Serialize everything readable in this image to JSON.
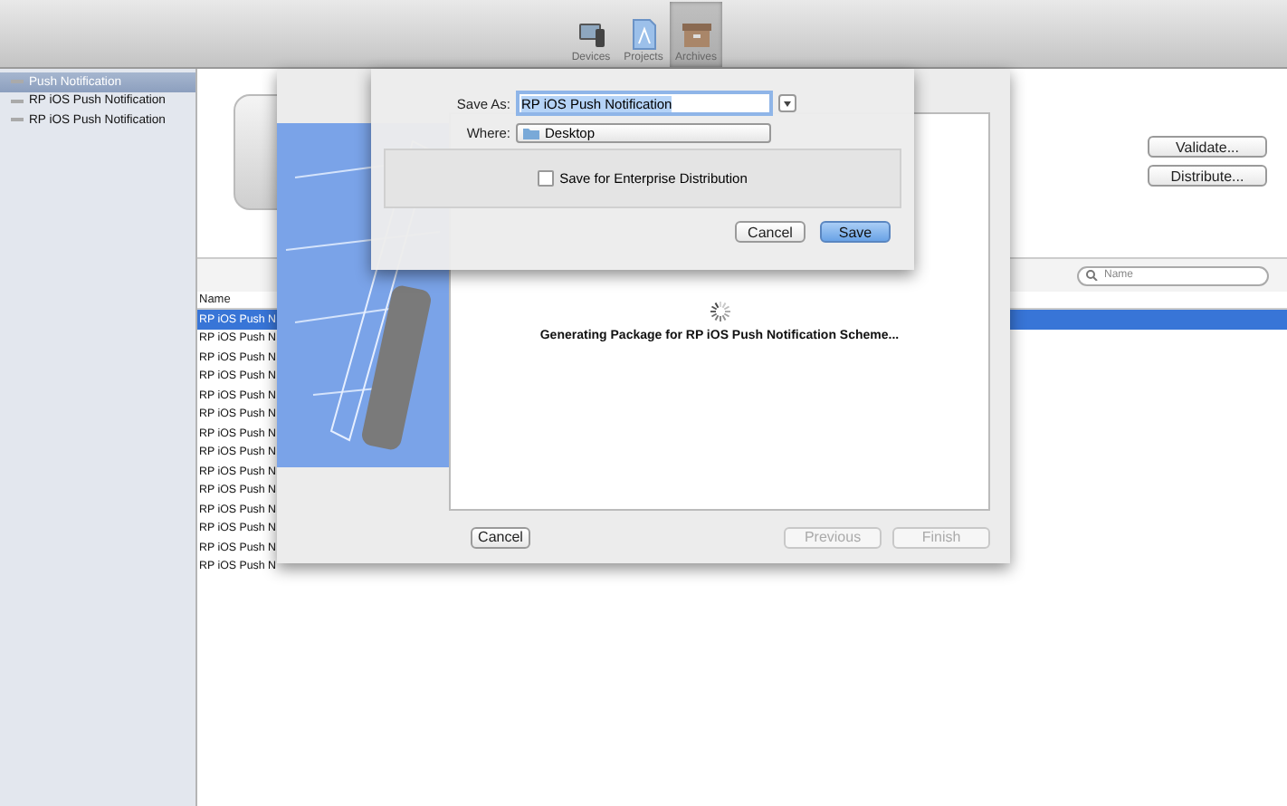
{
  "toolbar": {
    "items": [
      {
        "label": "Devices",
        "selected": false
      },
      {
        "label": "Projects",
        "selected": false
      },
      {
        "label": "Archives",
        "selected": true
      }
    ]
  },
  "sidebar": {
    "items": [
      {
        "label": "Push Notification",
        "selected": true
      },
      {
        "label": "RP iOS Push Notification",
        "selected": false
      },
      {
        "label": "RP iOS Push Notification",
        "selected": false
      }
    ]
  },
  "actions": [
    "Validate...",
    "Distribute..."
  ],
  "search": {
    "placeholder": "Name"
  },
  "table": {
    "columns": [
      "Name"
    ],
    "rows": [
      {
        "name": "RP iOS Push N",
        "selected": true
      },
      {
        "name": "RP iOS Push N",
        "selected": false
      },
      {
        "name": "RP iOS Push N",
        "selected": false
      },
      {
        "name": "RP iOS Push N",
        "selected": false
      },
      {
        "name": "RP iOS Push N",
        "selected": false
      },
      {
        "name": "RP iOS Push N",
        "selected": false
      },
      {
        "name": "RP iOS Push N",
        "selected": false
      },
      {
        "name": "RP iOS Push N",
        "selected": false
      },
      {
        "name": "RP iOS Push N",
        "selected": false
      },
      {
        "name": "RP iOS Push N",
        "selected": false
      },
      {
        "name": "RP iOS Push N",
        "selected": false
      },
      {
        "name": "RP iOS Push N",
        "selected": false
      },
      {
        "name": "RP iOS Push N",
        "selected": false
      },
      {
        "name": "RP iOS Push N",
        "selected": false
      }
    ]
  },
  "wizard": {
    "message": "Generating Package for RP iOS Push Notification Scheme...",
    "buttons": [
      {
        "label": "Cancel",
        "disabled": false
      },
      {
        "label": "Previous",
        "disabled": true
      },
      {
        "label": "Finish",
        "disabled": true
      }
    ]
  },
  "save_sheet": {
    "save_as_label": "Save As:",
    "save_as_value": "RP iOS Push Notification",
    "where_label": "Where:",
    "where_value": "Desktop",
    "enterprise": {
      "label": "Save for Enterprise Distribution",
      "checked": false
    },
    "buttons": [
      {
        "label": "Cancel",
        "default": false
      },
      {
        "label": "Save",
        "default": true
      }
    ]
  }
}
